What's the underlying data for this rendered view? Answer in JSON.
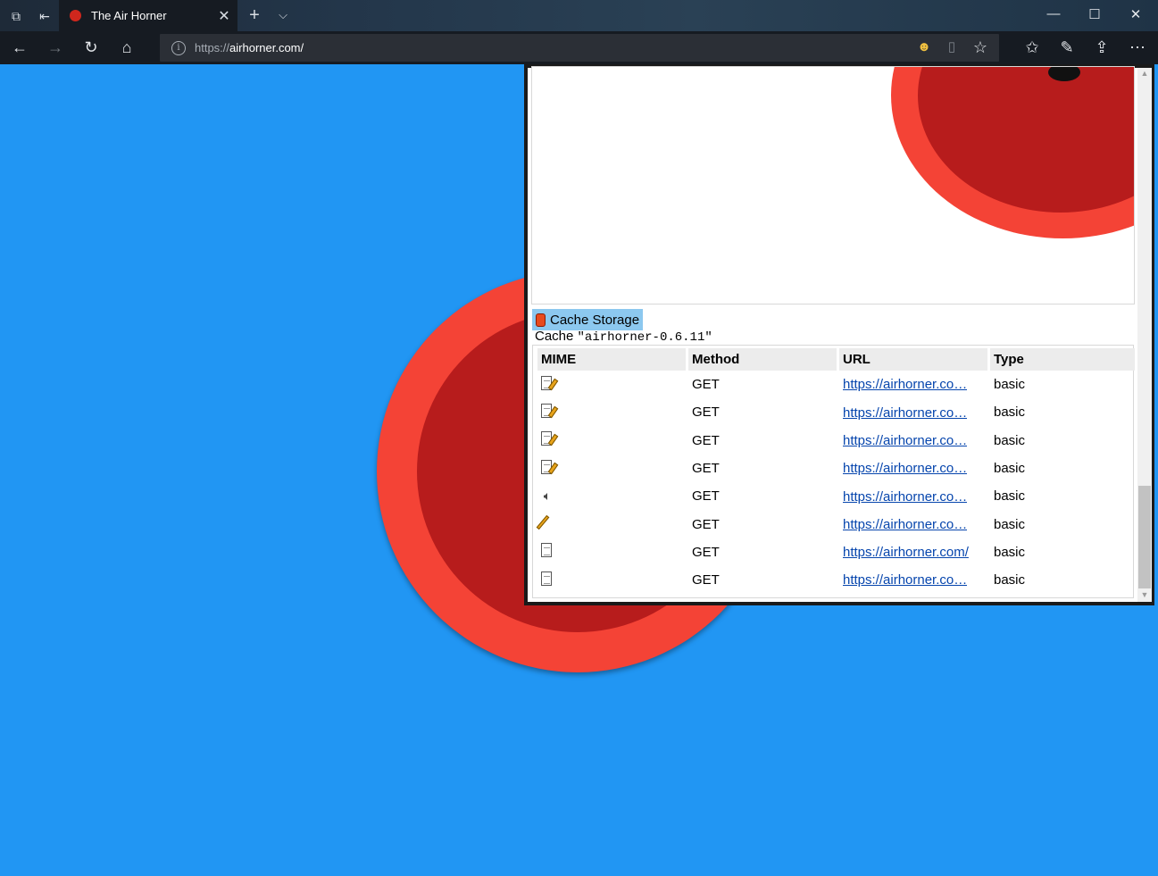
{
  "titlebar": {
    "tab_title": "The Air Horner",
    "tab_close_icon": "close-icon",
    "new_tab_icon": "plus-icon",
    "tab_menu_icon": "chevron-down-icon",
    "window_controls": [
      "minimize-icon",
      "maximize-icon",
      "close-icon"
    ]
  },
  "navbar": {
    "address_protocol": "https://",
    "address_rest": "airhorner.com/",
    "icons": [
      "back-icon",
      "forward-icon",
      "refresh-icon",
      "home-icon",
      "info-icon",
      "user-icon",
      "reading-view-icon",
      "favorite-star-icon",
      "favorites-hub-icon",
      "pen-icon",
      "share-icon",
      "more-icon"
    ]
  },
  "page": {
    "background_color": "#2196f3",
    "horn_outer_color": "#f44336",
    "horn_inner_color": "#b71c1c"
  },
  "devtools": {
    "cache_heading": "Cache Storage",
    "cache_name_prefix": "Cache ",
    "cache_name": "\"airhorner-0.6.11\"",
    "columns": [
      "MIME",
      "Method",
      "URL",
      "Type"
    ],
    "rows": [
      {
        "mime_icon": "edit-document-icon",
        "method": "GET",
        "url": "https://airhorner.co…",
        "type": "basic"
      },
      {
        "mime_icon": "edit-document-icon",
        "method": "GET",
        "url": "https://airhorner.co…",
        "type": "basic"
      },
      {
        "mime_icon": "edit-document-icon",
        "method": "GET",
        "url": "https://airhorner.co…",
        "type": "basic"
      },
      {
        "mime_icon": "edit-document-icon",
        "method": "GET",
        "url": "https://airhorner.co…",
        "type": "basic"
      },
      {
        "mime_icon": "audio-icon",
        "method": "GET",
        "url": "https://airhorner.co…",
        "type": "basic"
      },
      {
        "mime_icon": "pencil-icon",
        "method": "GET",
        "url": "https://airhorner.co…",
        "type": "basic"
      },
      {
        "mime_icon": "document-icon",
        "method": "GET",
        "url": "https://airhorner.com/",
        "type": "basic"
      },
      {
        "mime_icon": "document-icon",
        "method": "GET",
        "url": "https://airhorner.co…",
        "type": "basic"
      }
    ]
  }
}
